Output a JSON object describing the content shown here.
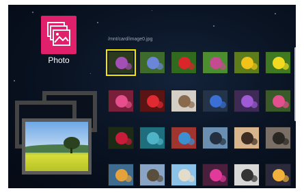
{
  "app": {
    "label": "Photo",
    "icon": "photo-album-icon",
    "accent": "#e0206b"
  },
  "browser": {
    "path": "/mnt/card/image0.jpg",
    "selected_index": 0
  },
  "preview": {
    "icon": "landscape-thumbnail"
  },
  "thumbnails": [
    {
      "name": "thumb-flower-dark",
      "bg": "#2b3a1c",
      "fg": "#a44fb5"
    },
    {
      "name": "thumb-aster-blue",
      "bg": "#3e6a2c",
      "fg": "#6b86d8"
    },
    {
      "name": "thumb-red-flowers",
      "bg": "#2f6a1e",
      "fg": "#d8262a"
    },
    {
      "name": "thumb-field-flowers",
      "bg": "#4b8d2f",
      "fg": "#c44b8f"
    },
    {
      "name": "thumb-sunflowers",
      "bg": "#5d7c1b",
      "fg": "#f0c21a"
    },
    {
      "name": "thumb-yellow-flowers",
      "bg": "#3f7a23",
      "fg": "#f2da20"
    },
    {
      "name": "thumb-pink-bouquet",
      "bg": "#7a1f3a",
      "fg": "#e74f8c"
    },
    {
      "name": "thumb-red-roses",
      "bg": "#5a1414",
      "fg": "#e02a32"
    },
    {
      "name": "thumb-cat",
      "bg": "#d4cfc6",
      "fg": "#8a6a4c"
    },
    {
      "name": "thumb-blue-flowers",
      "bg": "#23344a",
      "fg": "#3a6fd4"
    },
    {
      "name": "thumb-purple-flowers",
      "bg": "#3d2a55",
      "fg": "#a05ad6"
    },
    {
      "name": "thumb-pink-flower",
      "bg": "#3a5a2a",
      "fg": "#e2508e"
    },
    {
      "name": "thumb-red-rose",
      "bg": "#1d2b16",
      "fg": "#c81c3a"
    },
    {
      "name": "thumb-teal-water",
      "bg": "#1e6e7d",
      "fg": "#4fb3c7"
    },
    {
      "name": "thumb-mosaic",
      "bg": "#a0342f",
      "fg": "#3d8fd0"
    },
    {
      "name": "thumb-city-sky",
      "bg": "#6b8fb0",
      "fg": "#24303f"
    },
    {
      "name": "thumb-people-sunset",
      "bg": "#d9b58e",
      "fg": "#3b2d22"
    },
    {
      "name": "thumb-street",
      "bg": "#7a6f66",
      "fg": "#2a2622"
    },
    {
      "name": "thumb-river-sunset",
      "bg": "#3f6b8f",
      "fg": "#e6a23a"
    },
    {
      "name": "thumb-mountain-town",
      "bg": "#8aa4c5",
      "fg": "#5a4f3c"
    },
    {
      "name": "thumb-person-beach",
      "bg": "#8cc2e8",
      "fg": "#e3dccb"
    },
    {
      "name": "thumb-magenta-flowers",
      "bg": "#4a1f3d",
      "fg": "#e23a9a"
    },
    {
      "name": "thumb-bw-person",
      "bg": "#d8d8d8",
      "fg": "#333333"
    },
    {
      "name": "thumb-sunset-lake",
      "bg": "#2b2a3c",
      "fg": "#f3b03a"
    }
  ]
}
